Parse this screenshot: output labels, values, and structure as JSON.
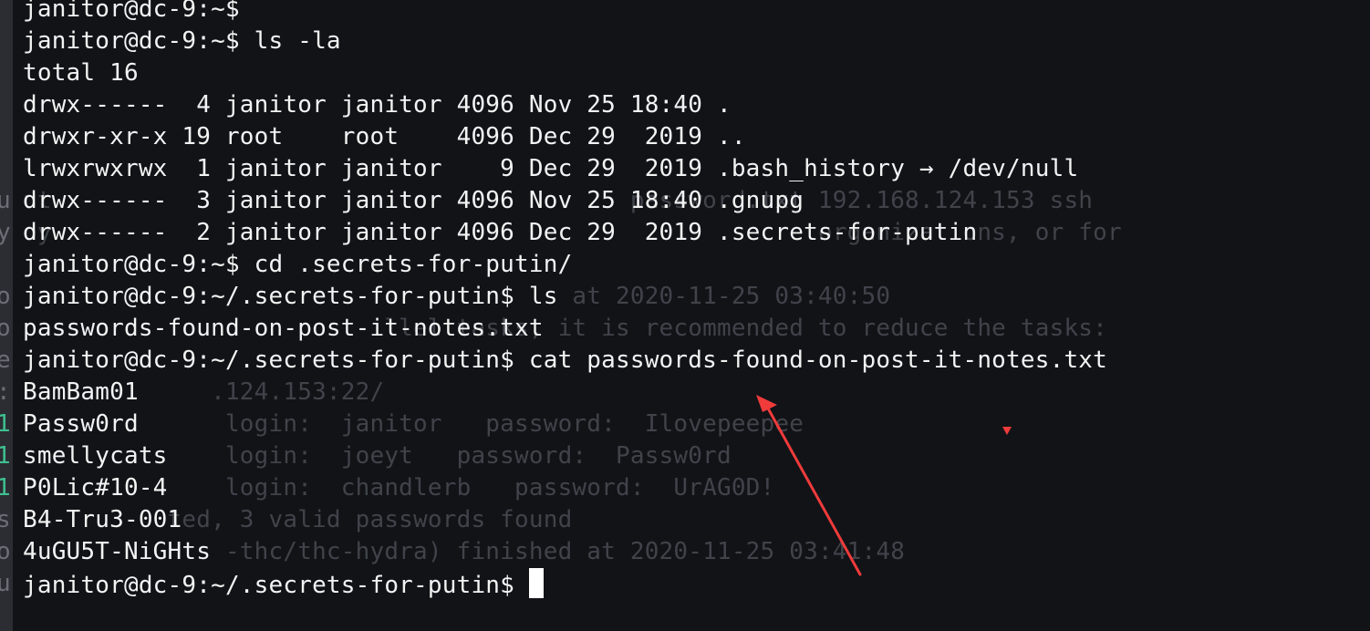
{
  "terminal": {
    "lines": [
      "janitor@dc-9:~$",
      "janitor@dc-9:~$ ls -la",
      "total 16",
      "drwx------  4 janitor janitor 4096 Nov 25 18:40 .",
      "drwxr-xr-x 19 root    root    4096 Dec 29  2019 ..",
      "lrwxrwxrwx  1 janitor janitor    9 Dec 29  2019 .bash_history → /dev/null",
      "drwx------  3 janitor janitor 4096 Nov 25 18:40 .gnupg",
      "drwx------  2 janitor janitor 4096 Dec 29  2019 .secrets-for-putin",
      "janitor@dc-9:~$ cd .secrets-for-putin/",
      "janitor@dc-9:~/.secrets-for-putin$ ls",
      "passwords-found-on-post-it-notes.txt",
      "janitor@dc-9:~/.secrets-for-putin$ cat passwords-found-on-post-it-notes.txt",
      "BamBam01",
      "Passw0rd",
      "smellycats",
      "P0Lic#10-4",
      "B4-Tru3-001",
      "4uGU5T-NiGHts"
    ],
    "prompt": "janitor@dc-9:~/.secrets-for-putin$ "
  },
  "background_window": {
    "lines": [
      "",
      "",
      "",
      "",
      "",
      "",
      "ut                                        password.txt 192.168.124.153 ssh",
      "oy                                                     organizations, or for",
      "",
      "                                      at 2020-11-25 03:40:50",
      "                         llel tasks, it is recommended to reduce the tasks:",
      "",
      "             .124.153:22/",
      "              login:  janitor   password:  Ilovepeepee",
      "              login:  joeyt   password:  Passw0rd",
      "              login:  chandlerb   password:  UrAG0D!",
      "          ted, 3 valid passwords found",
      "              -thc/thc-hydra) finished at 2020-11-25 03:41:48"
    ],
    "edge_chars": [
      "",
      "",
      "",
      "",
      "",
      "",
      "u",
      "y",
      "",
      "o",
      "o",
      "e",
      ":",
      "1",
      "1",
      "1",
      "s",
      "o",
      "u"
    ]
  },
  "colors": {
    "background": "#111317",
    "foreground": "#f3f3f3",
    "ghost_text": "#40434a",
    "ghost_green": "#3fc08f",
    "annotation_arrow": "#f03b3b"
  }
}
